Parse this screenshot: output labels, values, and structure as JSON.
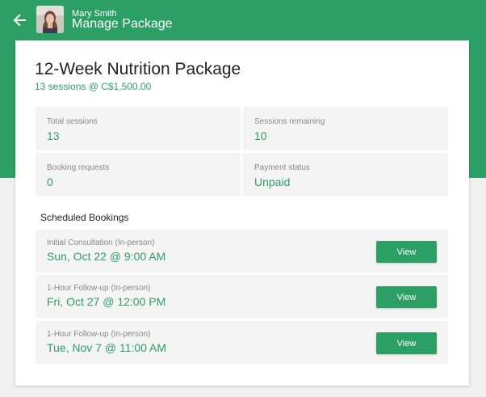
{
  "header": {
    "user_name": "Mary Smith",
    "title": "Manage Package"
  },
  "package": {
    "title": "12-Week Nutrition Package",
    "subtitle": "13 sessions @ C$1,500.00"
  },
  "stats": [
    {
      "label": "Total sessions",
      "value": "13"
    },
    {
      "label": "Sessions remaining",
      "value": "10"
    },
    {
      "label": "Booking requests",
      "value": "0"
    },
    {
      "label": "Payment status",
      "value": "Unpaid"
    }
  ],
  "bookings_section": {
    "title": "Scheduled Bookings"
  },
  "bookings": [
    {
      "type": "Initial Consultation (In-person)",
      "when": "Sun, Oct 22 @ 9:00 AM",
      "button": "View"
    },
    {
      "type": "1-Hour Follow-up (In-person)",
      "when": "Fri, Oct 27 @ 12:00 PM",
      "button": "View"
    },
    {
      "type": "1-Hour Follow-up (In-person)",
      "when": "Tue, Nov 7 @ 11:00 AM",
      "button": "View"
    }
  ],
  "icons": {
    "back": "arrow-left-icon",
    "avatar": "user-photo"
  },
  "colors": {
    "brand": "#2c9f64",
    "background": "#efefef",
    "card": "#ffffff",
    "tile": "#f4f4f4"
  }
}
